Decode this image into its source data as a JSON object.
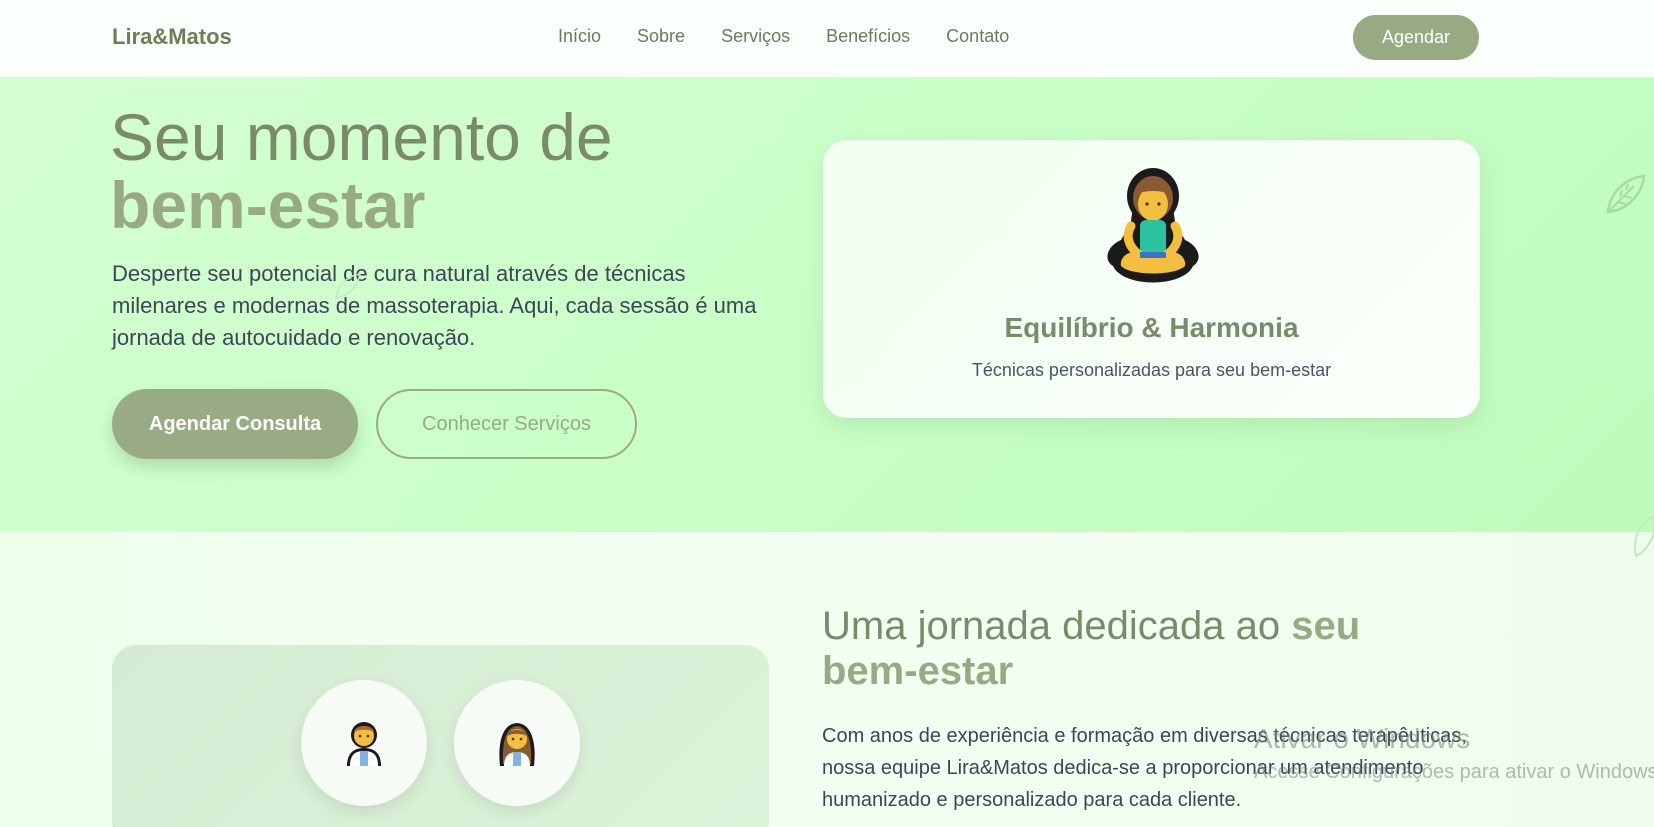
{
  "header": {
    "brand": "Lira&Matos",
    "nav": [
      "Início",
      "Sobre",
      "Serviços",
      "Benefícios",
      "Contato"
    ],
    "cta": "Agendar"
  },
  "hero": {
    "title_line1": "Seu momento de",
    "title_line2": "bem-estar",
    "description": "Desperte seu potencial de cura natural através de técnicas milenares e modernas de massoterapia. Aqui, cada sessão é uma jornada de autocuidado e renovação.",
    "primary_button": "Agendar Consulta",
    "secondary_button": "Conhecer Serviços",
    "card": {
      "icon": "person-lotus-position-icon",
      "title": "Equilíbrio & Harmonia",
      "subtitle": "Técnicas personalizadas para seu bem-estar"
    }
  },
  "about": {
    "title_part1": "Uma jornada dedicada ao ",
    "title_highlight": "seu bem-estar",
    "text": "Com anos de experiência e formação em diversas técnicas terapêuticas, nossa equipe Lira&Matos dedica-se a proporcionar um atendimento humanizado e personalizado para cada cliente.",
    "avatars": [
      "man-health-worker-icon",
      "woman-health-worker-icon"
    ]
  },
  "watermark": {
    "line1": "Ativar o Windows",
    "line2": "Acesse Configurações para ativar o Windows."
  },
  "colors": {
    "accent": "#97aa82",
    "hero_bg": "#c8ffc6",
    "text_dark": "#3c4656"
  }
}
